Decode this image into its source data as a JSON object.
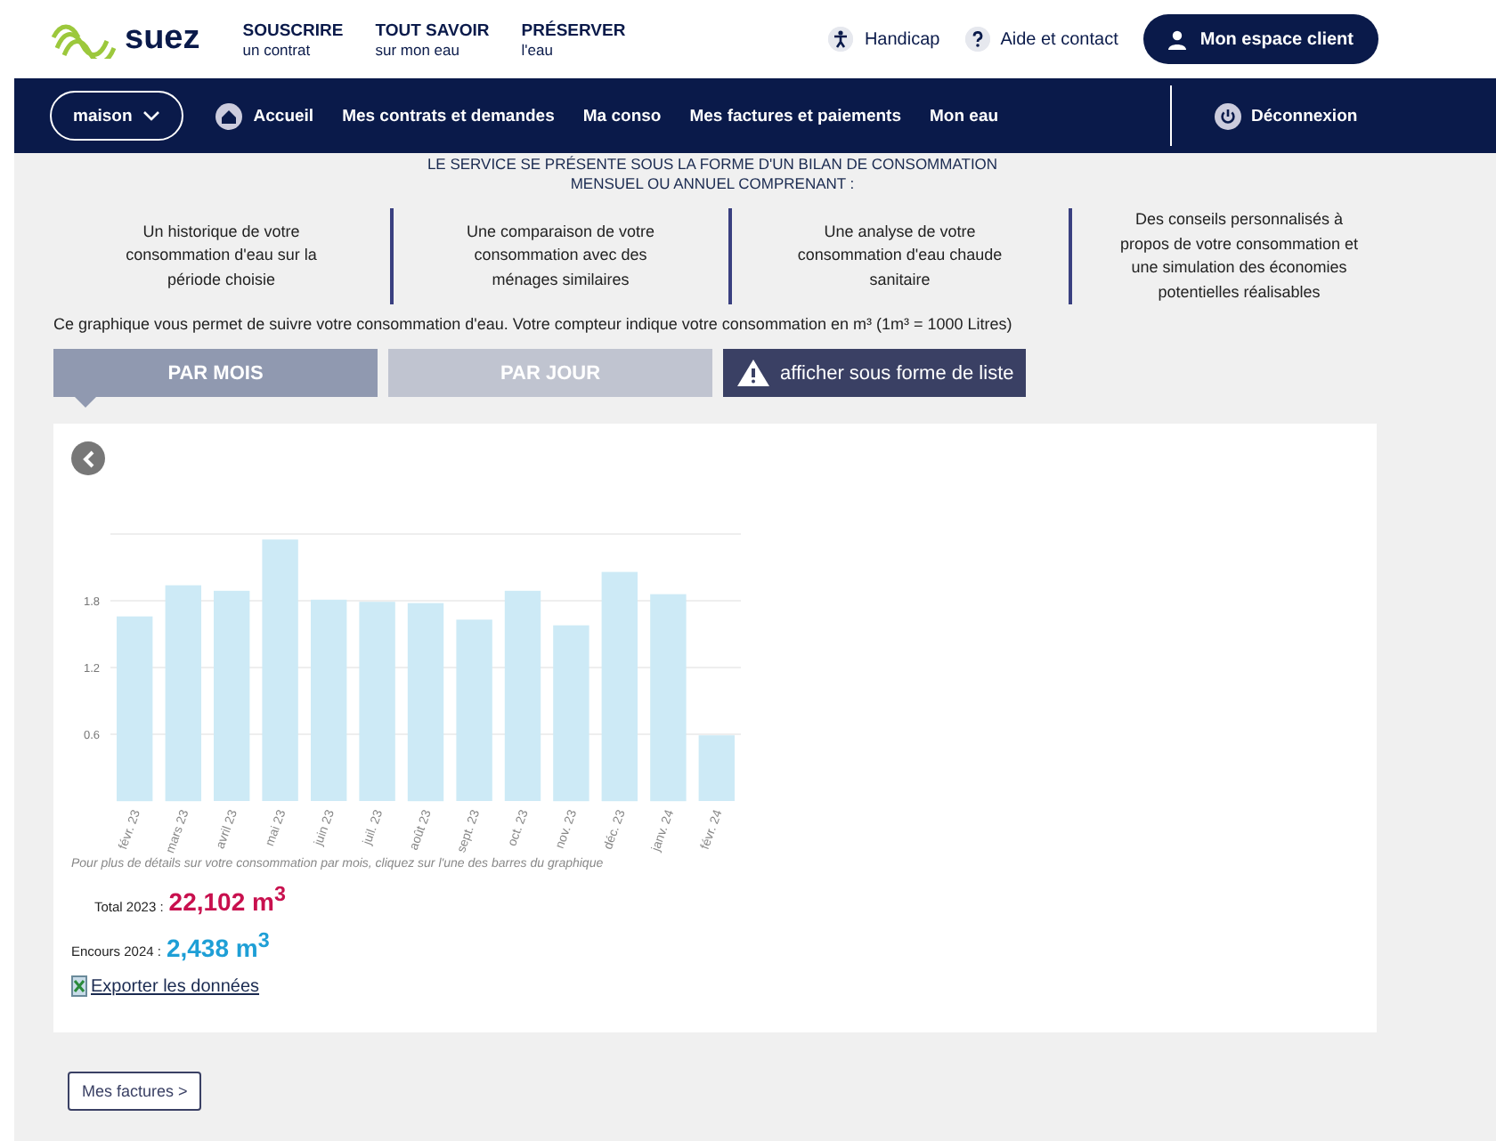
{
  "header": {
    "logo": "suez",
    "menu": [
      {
        "title": "SOUSCRIRE",
        "subtitle": "un contrat"
      },
      {
        "title": "TOUT SAVOIR",
        "subtitle": "sur mon eau"
      },
      {
        "title": "PRÉSERVER",
        "subtitle": "l'eau"
      }
    ],
    "links": [
      {
        "kind": "accessibility",
        "label": "Handicap"
      },
      {
        "kind": "help",
        "label": "Aide et contact"
      }
    ],
    "account_button": "Mon espace client"
  },
  "nav": {
    "home_select": "maison",
    "items": [
      {
        "kind": "home",
        "label": "Accueil"
      },
      {
        "kind": "plain",
        "label": "Mes contrats et demandes"
      },
      {
        "kind": "plain",
        "label": "Ma conso"
      },
      {
        "kind": "plain",
        "label": "Mes factures et paiements"
      },
      {
        "kind": "plain",
        "label": "Mon eau"
      }
    ],
    "logout": "Déconnexion"
  },
  "intro": {
    "heading": [
      "LE SERVICE SE PRÉSENTE SOUS LA FORME D'UN BILAN DE CONSOMMATION",
      "MENSUEL OU ANNUEL COMPRENANT :"
    ],
    "features": [
      "Un historique de votre consommation d'eau sur la période choisie",
      "Une comparaison de votre consommation avec des ménages similaires",
      "Une analyse de votre consommation d'eau chaude sanitaire",
      "Des conseils personnalisés à propos de votre consommation et une simulation des économies potentielles réalisables"
    ],
    "note": "Ce graphique vous permet de suivre votre consommation d'eau. Votre compteur indique votre consommation en m³ (1m³ = 1000 Litres)"
  },
  "tabs": [
    {
      "label": "PAR MOIS",
      "selected": true
    },
    {
      "label": "PAR JOUR",
      "selected": false
    }
  ],
  "list_button": "afficher sous forme de liste",
  "chart_panel": {
    "chart_data": {
      "type": "bar",
      "categories": [
        "févr. 23",
        "mars 23",
        "avril 23",
        "mai 23",
        "juin 23",
        "juil. 23",
        "août 23",
        "sept. 23",
        "oct. 23",
        "nov. 23",
        "déc. 23",
        "janv. 24",
        "févr. 24"
      ],
      "series": [
        {
          "color": "#cdeaf6",
          "values": [
            1.66,
            1.94,
            1.89,
            2.35,
            1.81,
            1.79,
            1.78,
            1.63,
            1.89,
            1.58,
            2.06,
            1.86,
            0.59
          ]
        }
      ],
      "grid": true,
      "ylim": [
        0,
        2.4
      ],
      "yticks": [
        0.6,
        1.2,
        1.8
      ]
    },
    "hint": "Pour plus de détails sur votre consommation par mois, cliquez sur l'une des barres du graphique",
    "totals": [
      {
        "label": "Total 2023 :",
        "value": "22,102 m$^{3}$",
        "color": "#c8104e"
      },
      {
        "label": "Encours 2024 :",
        "value": "2,438 m$^{3}$",
        "color": "#1e9fd6"
      }
    ],
    "export_link": "Exporter les données"
  },
  "footer_button": "Mes factures >"
}
